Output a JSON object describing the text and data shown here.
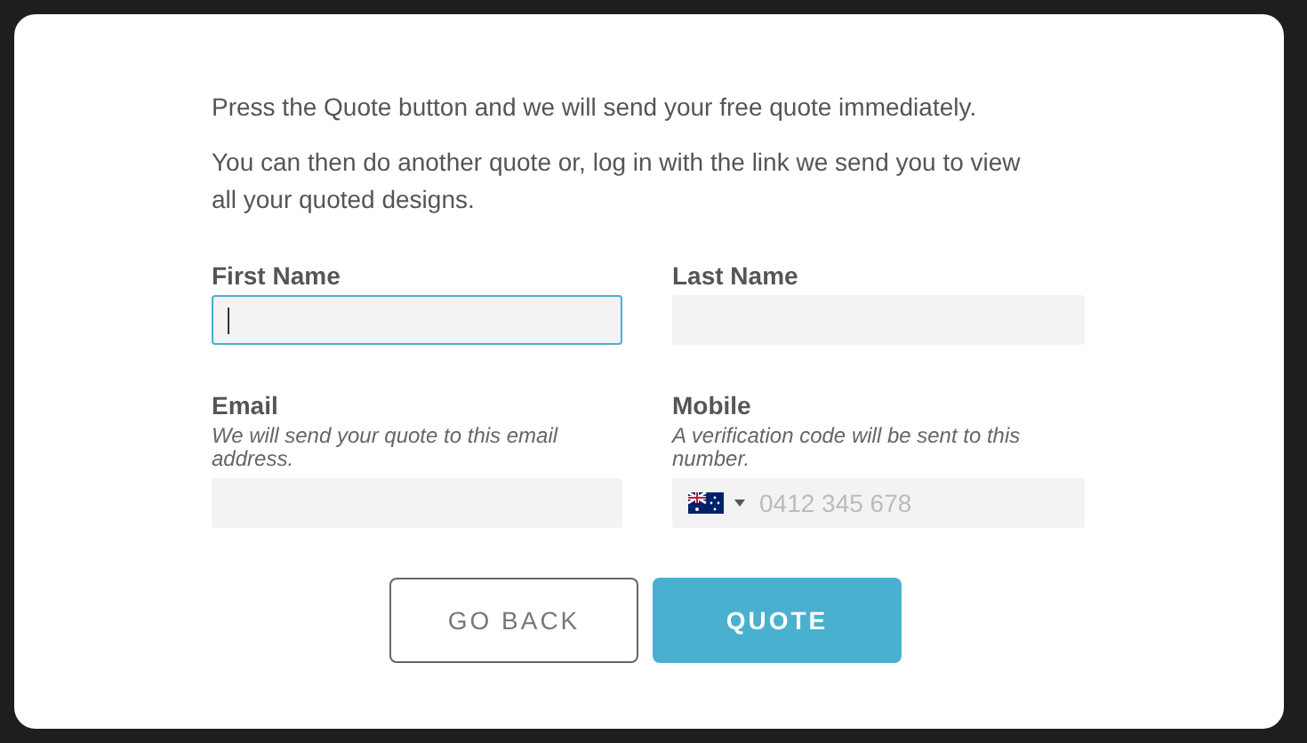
{
  "intro": [
    "Press the Quote button and we will send your free quote immediately.",
    "You can then do another quote or, log in with the link we send you to view all your quoted designs."
  ],
  "fields": [
    {
      "kind": "text",
      "label": "First Name",
      "focused": true
    },
    {
      "kind": "text",
      "label": "Last Name",
      "focused": false
    },
    {
      "kind": "text",
      "label": "Email",
      "hint": "We will send your quote to this email address.",
      "focused": false
    },
    {
      "kind": "phone",
      "label": "Mobile",
      "hint": "A verification code will be sent to this number.",
      "placeholder": "0412 345 678",
      "focused": false
    }
  ],
  "buttons": [
    {
      "kind": "secondary",
      "label": "GO BACK"
    },
    {
      "kind": "primary",
      "label": "QUOTE"
    }
  ]
}
